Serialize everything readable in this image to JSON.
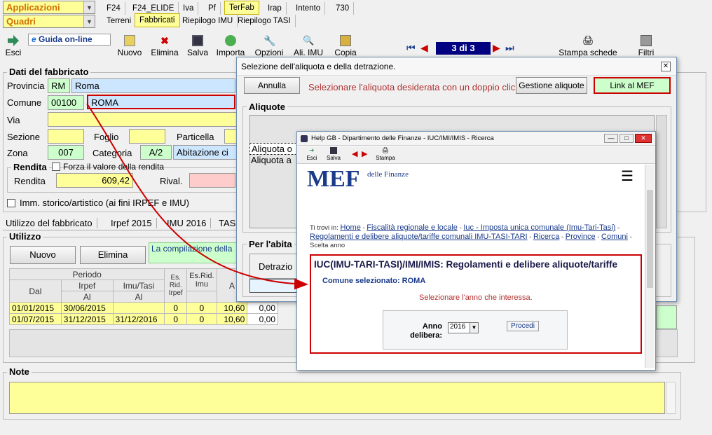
{
  "top": {
    "app_combo": "Applicazioni",
    "section_combo": "Quadri"
  },
  "menu_tabs_row1": [
    "F24",
    "F24_ELIDE",
    "Iva",
    "Pf",
    "TerFab",
    "Irap",
    "Intento",
    "730"
  ],
  "menu_tabs_row2": [
    "Terreni",
    "Fabbricati",
    "Riepilogo IMU",
    "Riepilogo TASI"
  ],
  "toolbar": {
    "esci": "Esci",
    "guida": "Guida on-line",
    "nuovo": "Nuovo",
    "elimina": "Elimina",
    "salva": "Salva",
    "importa": "Importa",
    "opzioni": "Opzioni",
    "ali_imu": "Ali. IMU",
    "copia": "Copia",
    "page_counter": "3 di 3",
    "stampa_schede": "Stampa schede",
    "filtri": "Filtri"
  },
  "dati": {
    "title": "Dati del fabbricato",
    "provincia_label": "Provincia",
    "provincia_code": "RM",
    "provincia_name": "Roma",
    "comune_label": "Comune",
    "comune_code": "00100",
    "comune_name": "ROMA",
    "via_label": "Via",
    "sezione_label": "Sezione",
    "foglio_label": "Foglio",
    "particella_label": "Particella",
    "zona_label": "Zona",
    "zona_value": "007",
    "categoria_label": "Categoria",
    "categoria_code": "A/2",
    "categoria_desc": "Abitazione ci",
    "rendita_title": "Rendita",
    "forza_label": "Forza il valore della rendita",
    "rendita_label": "Rendita",
    "rendita_value": "609,42",
    "rival_label": "Rival.",
    "storico_label": "Imm. storico/artistico (ai fini IRPEF e IMU)"
  },
  "subtabs": [
    "Utilizzo del fabbricato",
    "Irpef 2015",
    "IMU 2016",
    "TAS"
  ],
  "utilizzo": {
    "title": "Utilizzo",
    "nuovo": "Nuovo",
    "elimina": "Elimina",
    "info": "La compilazione della",
    "headers": {
      "periodo": "Periodo",
      "irpef": "Irpef",
      "imu_tasi": "Imu/Tasi",
      "dal": "Dal",
      "al": "Al",
      "al2": "Al",
      "es_rid_irpef": "Es. Rid. Irpef",
      "es_rid_imu": "Es.Rid. Imu",
      "a": "A"
    },
    "rows": [
      [
        "01/01/2015",
        "30/06/2015",
        "",
        "0",
        "0",
        "10,60",
        "0,00"
      ],
      [
        "01/07/2015",
        "31/12/2015",
        "31/12/2016",
        "0",
        "0",
        "10,60",
        "0,00"
      ]
    ]
  },
  "note": {
    "title": "Note"
  },
  "dialog": {
    "title": "Selezione dell'aliquota e della detrazione.",
    "annulla": "Annulla",
    "instruction": "Selezionare l'aliquota desiderata con un doppio click",
    "gestione": "Gestione aliquote",
    "link_mef": "Link al MEF",
    "aliquote_title": "Aliquote",
    "row1": "Aliquota o",
    "row2": "Aliquota a",
    "abitazione_title": "Per l'abita",
    "detrazione": "Detrazio"
  },
  "help": {
    "title": "Help GB - Dipartimento delle Finanze - IUC/IMI/IMIS - Ricerca",
    "esci": "Esci",
    "salva": "Salva",
    "stampa": "Stampa",
    "logo": "MEF",
    "logo_sub": "delle Finanze",
    "breadcrumb_prefix": "Ti trovi in:",
    "crumbs": [
      "Home",
      "Fiscalità regionale e locale",
      "Iuc - Imposta unica comunale (Imu-Tari-Tasi)",
      "Regolamenti e delibere aliquote/tariffe comunali IMU-TASI-TARI",
      "Ricerca",
      "Province",
      "Comuni"
    ],
    "crumb_last": "Scelta anno",
    "heading": "IUC(IMU-TARI-TASI)/IMI/IMIS: Regolamenti e delibere aliquote/tariffe",
    "comune_sel": "Comune selezionato: ROMA",
    "select_year": "Selezionare l'anno che interessa.",
    "anno_label": "Anno delibera:",
    "anno_value": "2016",
    "procedi": "Procedi"
  },
  "colors": {
    "highlight_red": "#cc0000",
    "link_green": "#ccffcc"
  }
}
